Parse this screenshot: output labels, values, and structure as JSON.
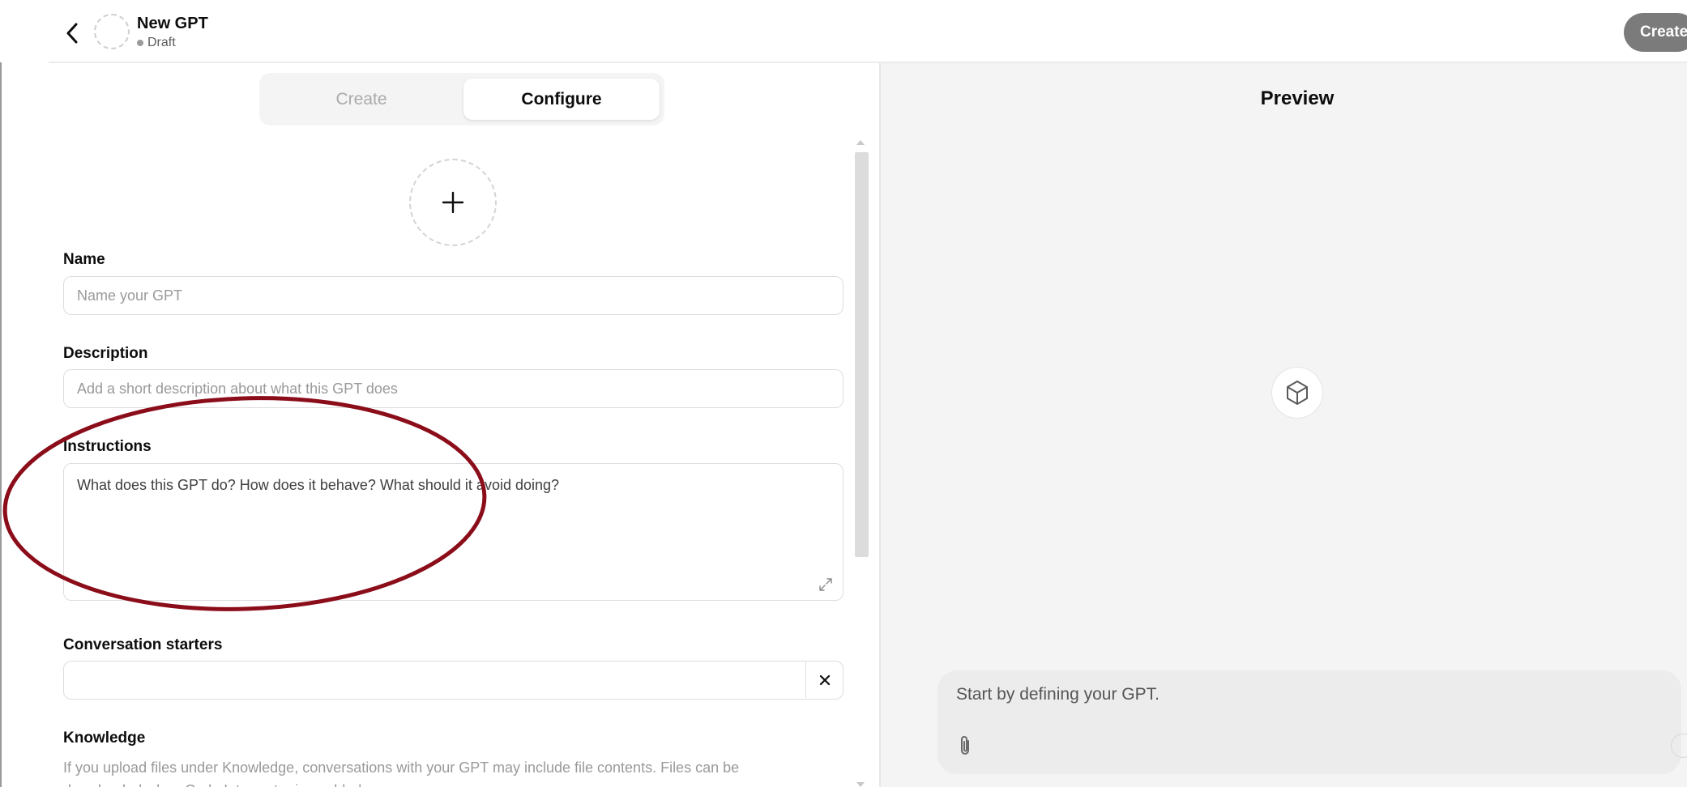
{
  "header": {
    "back_icon": "chevron-left-icon",
    "gpt_name": "New GPT",
    "status": "Draft",
    "create_label": "Create"
  },
  "tabs": {
    "create_label": "Create",
    "configure_label": "Configure",
    "active": "Configure"
  },
  "form": {
    "avatar_icon": "plus-icon",
    "name": {
      "label": "Name",
      "value": "",
      "placeholder": "Name your GPT"
    },
    "description": {
      "label": "Description",
      "value": "",
      "placeholder": "Add a short description about what this GPT does"
    },
    "instructions": {
      "label": "Instructions",
      "value": "",
      "placeholder": "What does this GPT do? How does it behave? What should it avoid doing?"
    },
    "conversation_starters": {
      "label": "Conversation starters",
      "value": "",
      "clear_label": "×"
    },
    "knowledge": {
      "label": "Knowledge",
      "text": "If you upload files under Knowledge, conversations with your GPT may include file contents. Files can be downloaded when Code Interpreter is enabled."
    }
  },
  "preview": {
    "title": "Preview",
    "logo_icon": "cube-icon",
    "composer_placeholder": "Start by defining your GPT.",
    "attach_icon": "paperclip-icon"
  },
  "annotation": {
    "shape": "ellipse",
    "color": "#8b0d1a",
    "target": "instructions"
  }
}
